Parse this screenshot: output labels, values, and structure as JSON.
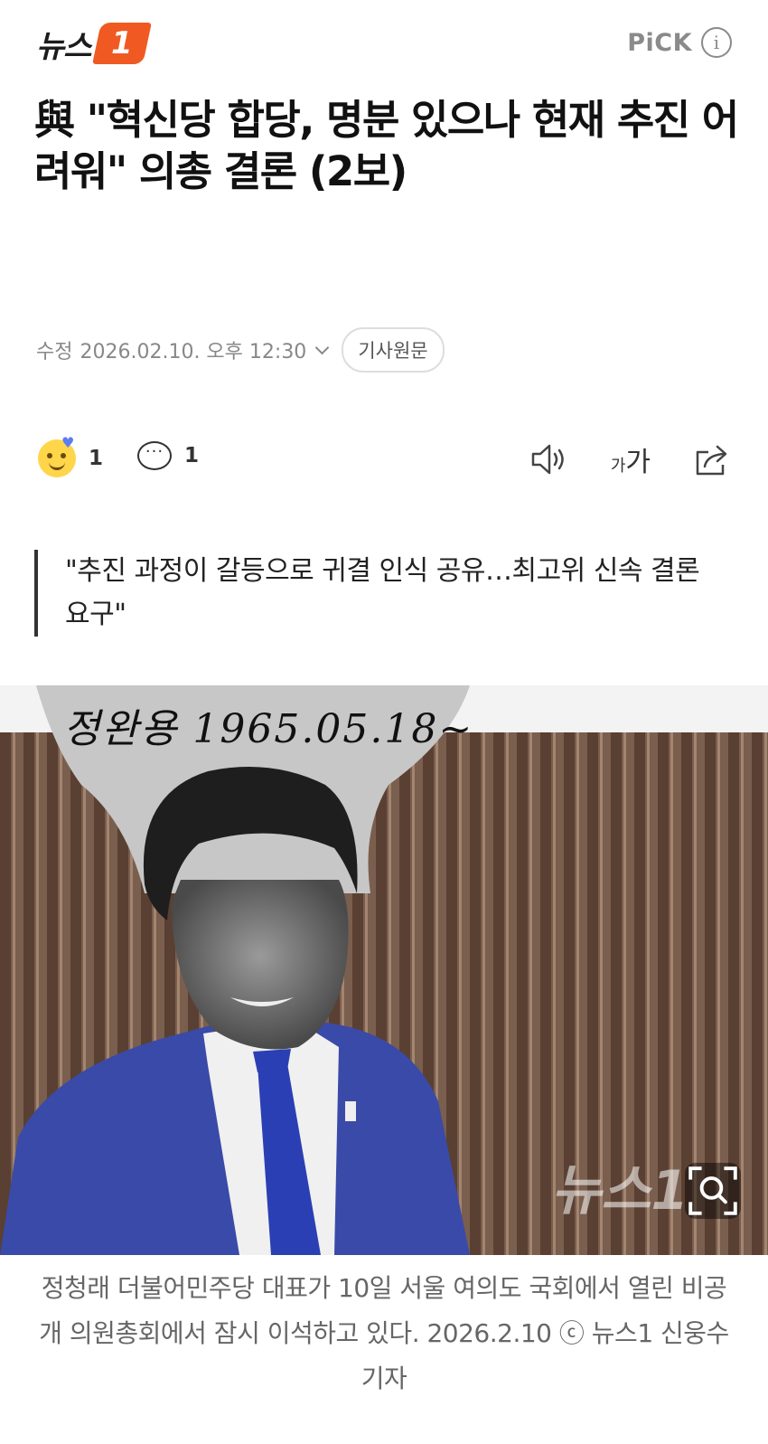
{
  "header": {
    "logo_text": "뉴스",
    "logo_badge": "1",
    "pick_label": "PiCK",
    "info_glyph": "i"
  },
  "article": {
    "title": "與 \"혁신당 합당, 명분 있으나 현재 추진 어려워\" 의총 결론 (2보)",
    "meta_label": "수정",
    "meta_date": "2026.02.10. 오후 12:30",
    "original_button": "기사원문",
    "reaction_count": "1",
    "comment_count": "1",
    "font_small": "가",
    "font_big": "가",
    "quote": "\"추진 과정이 갈등으로 귀결 인식 공유…최고위 신속 결론 요구\"",
    "photo_signature": "정완용 1965.05.18~",
    "photo_watermark": "뉴스1",
    "caption": "정청래 더불어민주당 대표가 10일 서울 여의도 국회에서 열린 비공개 의원총회에서 잠시 이석하고 있다. 2026.2.10 ⓒ 뉴스1 신웅수 기자"
  },
  "icons": {
    "reaction": "smile-emoji-icon",
    "comment": "comment-bubble-icon",
    "speaker": "speaker-icon",
    "share": "share-icon",
    "zoom": "zoom-icon"
  },
  "colors": {
    "brand_orange": "#f05a22",
    "text_primary": "#111111",
    "text_muted": "#888888"
  }
}
